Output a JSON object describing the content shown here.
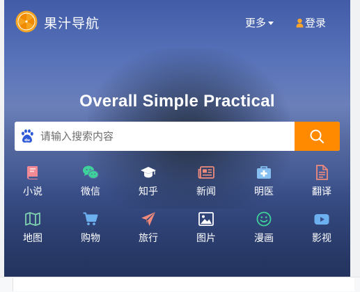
{
  "brand": {
    "name": "果汁导航",
    "logo": "orange-slice-logo"
  },
  "nav": {
    "more_label": "更多",
    "login_label": "登录"
  },
  "hero": {
    "slogan": "Overall Simple Practical"
  },
  "search": {
    "placeholder": "请输入搜索内容",
    "engine_icon": "baidu-paw-icon",
    "button_icon": "search-icon"
  },
  "colors": {
    "accent": "#ff8a00",
    "hero_bg": "#4a64ab",
    "login_icon": "#ffa52a"
  },
  "shortcuts": [
    {
      "label": "小说",
      "icon": "book-icon",
      "color": "#f28a96"
    },
    {
      "label": "微信",
      "icon": "wechat-icon",
      "color": "#3fd19a"
    },
    {
      "label": "知乎",
      "icon": "graduation-cap-icon",
      "color": "#ffffff"
    },
    {
      "label": "新闻",
      "icon": "newspaper-icon",
      "color": "#f08a7c"
    },
    {
      "label": "明医",
      "icon": "medical-kit-icon",
      "color": "#86c0f2"
    },
    {
      "label": "翻译",
      "icon": "document-icon",
      "color": "#f08a7c"
    },
    {
      "label": "地图",
      "icon": "map-icon",
      "color": "#7fd0b0"
    },
    {
      "label": "购物",
      "icon": "cart-icon",
      "color": "#6cb0f0"
    },
    {
      "label": "旅行",
      "icon": "paper-plane-icon",
      "color": "#f08a7c"
    },
    {
      "label": "图片",
      "icon": "image-icon",
      "color": "#ffffff"
    },
    {
      "label": "漫画",
      "icon": "smile-icon",
      "color": "#3fd19a"
    },
    {
      "label": "影视",
      "icon": "play-icon",
      "color": "#6cb0f0"
    }
  ]
}
